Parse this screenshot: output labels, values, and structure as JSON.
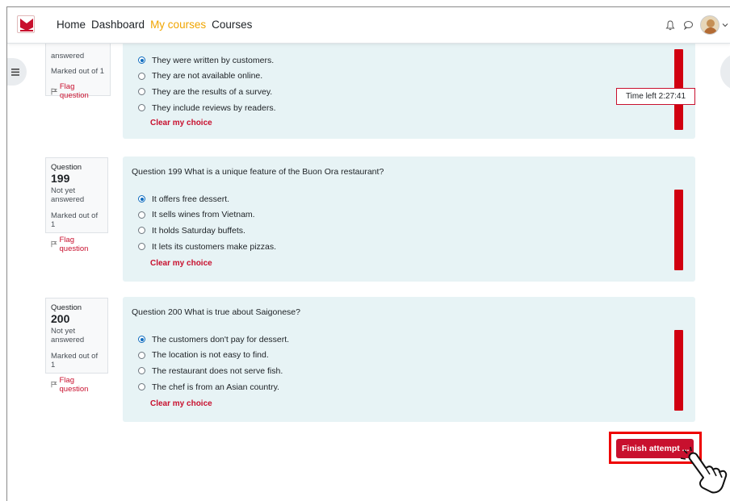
{
  "nav": {
    "links": [
      {
        "label": "Home",
        "active": false
      },
      {
        "label": "Dashboard",
        "active": false
      },
      {
        "label": "My courses",
        "active": true
      },
      {
        "label": "Courses",
        "active": false
      }
    ],
    "icons": [
      "bell-icon",
      "chat-bubble-icon",
      "avatar",
      "chevron-down-icon"
    ]
  },
  "timer": {
    "label": "Time left 2:27:41"
  },
  "questions": [
    {
      "info_status": "answered",
      "info_marked": "Marked out of 1",
      "info_flag": "Flag question",
      "options": [
        {
          "label": "They were written by customers.",
          "selected": true
        },
        {
          "label": "They are not available online.",
          "selected": false
        },
        {
          "label": "They are the results of a survey.",
          "selected": false
        },
        {
          "label": "They include reviews by readers.",
          "selected": false
        }
      ],
      "clear_label": "Clear my choice"
    },
    {
      "info_prefix": "Question",
      "info_number": "199",
      "info_status_1": "Not yet",
      "info_status_2": "answered",
      "info_marked": "Marked out of 1",
      "info_flag": "Flag question",
      "text": "Question 199 What is a unique feature of the Buon Ora restaurant?",
      "options": [
        {
          "label": "It offers free dessert.",
          "selected": true
        },
        {
          "label": "It sells wines from Vietnam.",
          "selected": false
        },
        {
          "label": "It holds Saturday buffets.",
          "selected": false
        },
        {
          "label": "It lets its customers make pizzas.",
          "selected": false
        }
      ],
      "clear_label": "Clear my choice"
    },
    {
      "info_prefix": "Question",
      "info_number": "200",
      "info_status_1": "Not yet",
      "info_status_2": "answered",
      "info_marked": "Marked out of 1",
      "info_flag": "Flag question",
      "text": "Question 200 What is true about Saigonese?",
      "options": [
        {
          "label": "The customers don't pay for dessert.",
          "selected": true
        },
        {
          "label": "The location is not easy to find.",
          "selected": false
        },
        {
          "label": "The restaurant does not serve fish.",
          "selected": false
        },
        {
          "label": "The chef is from an Asian country.",
          "selected": false
        }
      ],
      "clear_label": "Clear my choice"
    }
  ],
  "finish_button": {
    "label": "Finish attempt ..."
  },
  "colors": {
    "accent": "#f0a500",
    "danger": "#c8102e",
    "panel": "#e7f3f5",
    "radio": "#0f6cbf"
  }
}
